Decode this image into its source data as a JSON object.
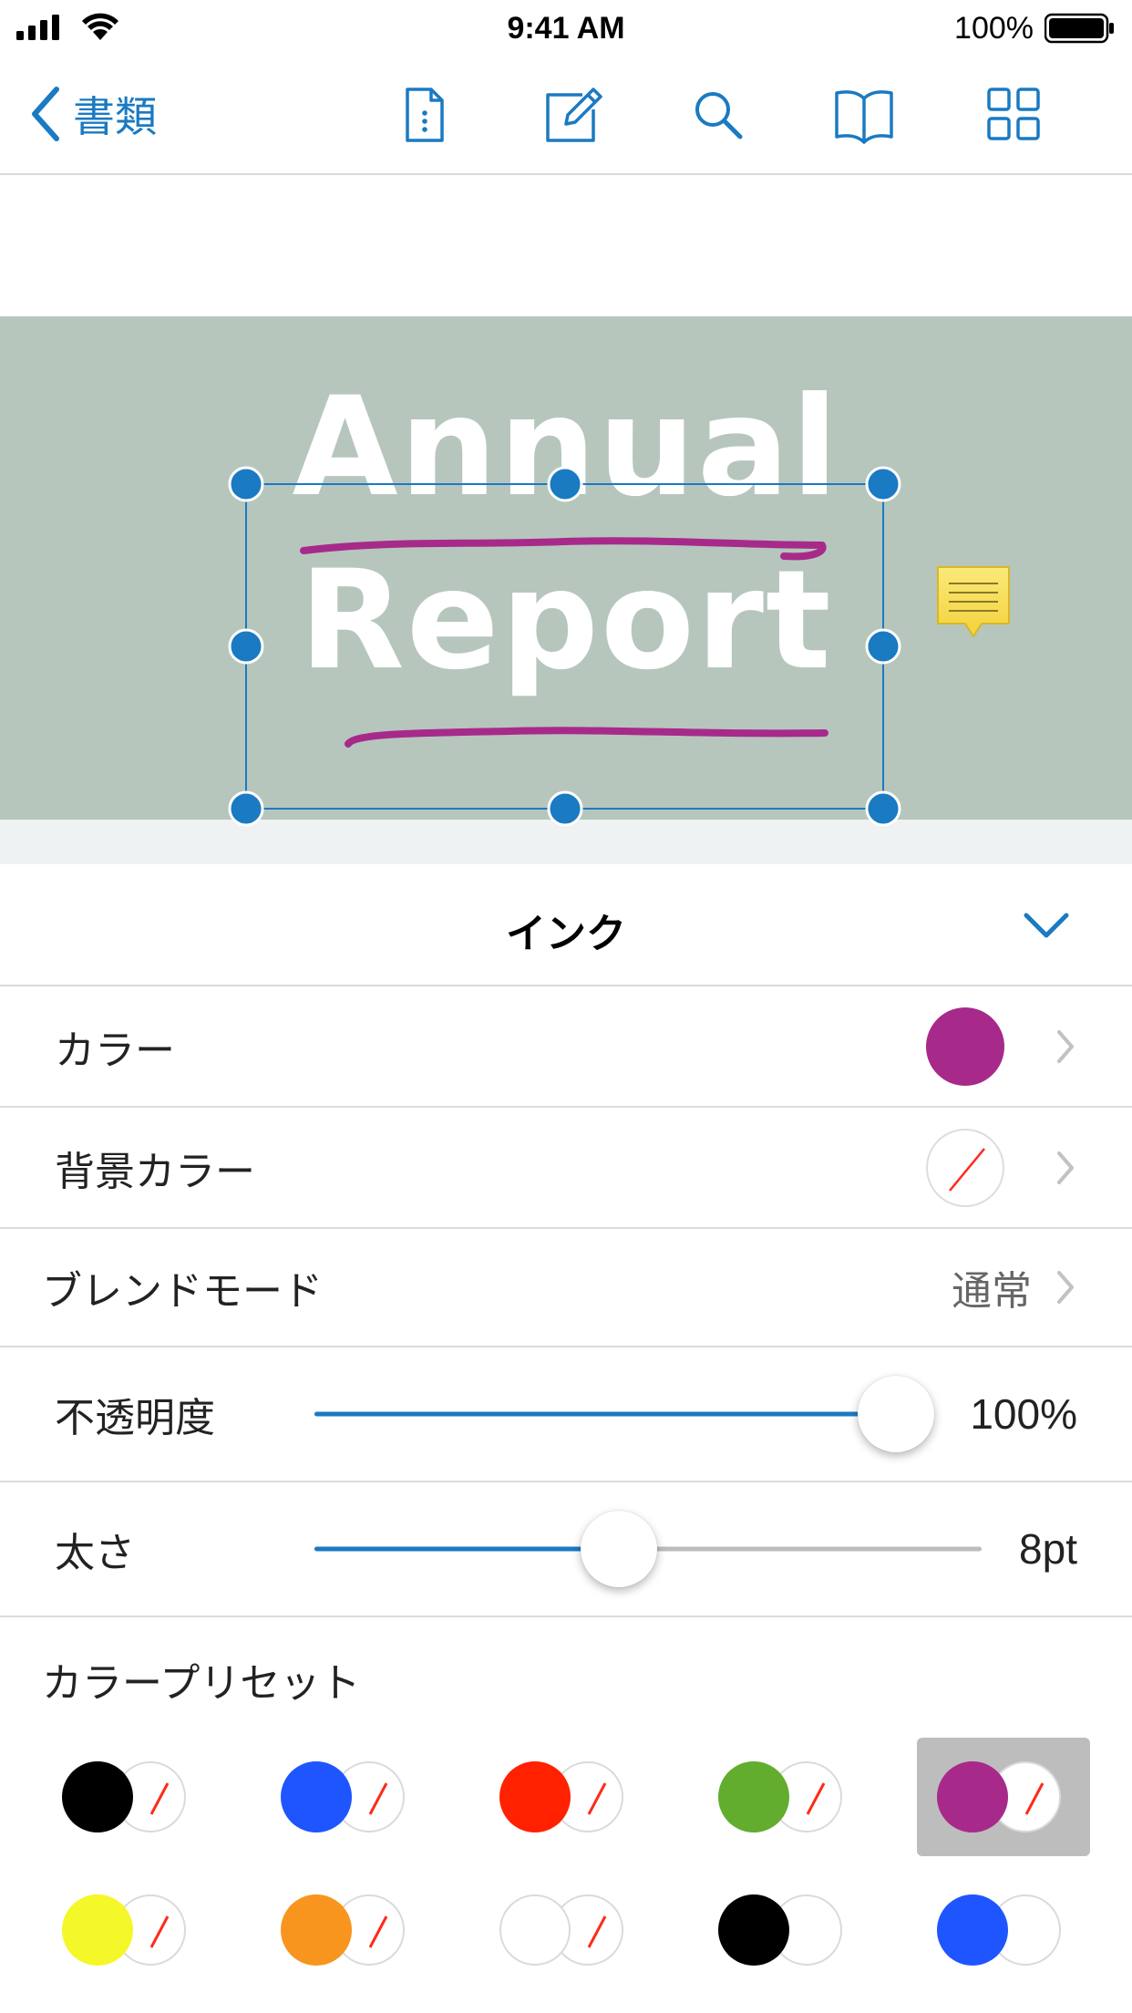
{
  "status_bar": {
    "time": "9:41 AM",
    "battery": "100%"
  },
  "nav": {
    "back_label": "書類",
    "icons": [
      "document-info-icon",
      "edit-annotate-icon",
      "search-icon",
      "book-outline-icon",
      "thumbnails-grid-icon"
    ]
  },
  "document": {
    "title_line1": "Annual",
    "title_line2": "Report",
    "ink_color": "#a72a8b",
    "cover_color": "#b6c6bd"
  },
  "panel": {
    "title": "インク",
    "color_label": "カラー",
    "color_value": "#a72a8b",
    "bg_color_label": "背景カラー",
    "bg_color_value": "none",
    "blend_label": "ブレンドモード",
    "blend_value": "通常",
    "opacity_label": "不透明度",
    "opacity_value": "100%",
    "opacity_fraction": 1.0,
    "thickness_label": "太さ",
    "thickness_value": "8pt",
    "thickness_fraction": 0.45,
    "presets_label": "カラープリセット"
  },
  "presets": [
    {
      "color": "#000000",
      "background": "none",
      "selected": false
    },
    {
      "color": "#1f55ff",
      "background": "none",
      "selected": false
    },
    {
      "color": "#ff2100",
      "background": "none",
      "selected": false
    },
    {
      "color": "#62ad2e",
      "background": "none",
      "selected": false
    },
    {
      "color": "#a72a8b",
      "background": "none",
      "selected": true
    },
    {
      "color": "#f4f728",
      "background": "none",
      "selected": false
    },
    {
      "color": "#f7951e",
      "background": "none",
      "selected": false
    },
    {
      "color": "#ffffff",
      "background": "none",
      "selected": false
    },
    {
      "color": "#000000",
      "background": "#ffffff",
      "selected": false
    },
    {
      "color": "#1f55ff",
      "background": "#ffffff",
      "selected": false
    }
  ]
}
